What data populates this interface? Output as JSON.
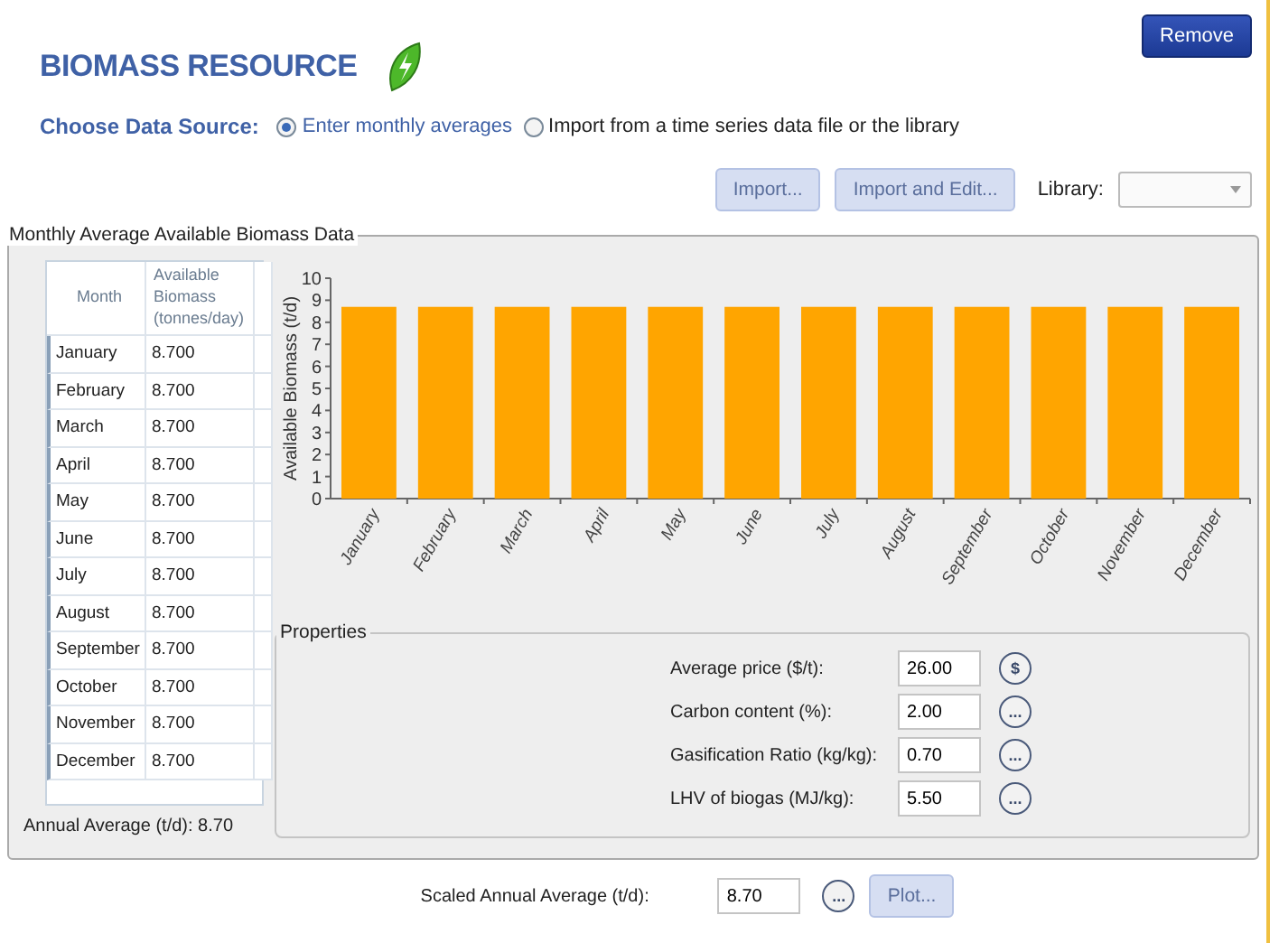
{
  "header": {
    "title": "BIOMASS RESOURCE",
    "remove_button": "Remove"
  },
  "data_source": {
    "label": "Choose Data Source:",
    "options": [
      {
        "label": "Enter monthly averages",
        "selected": true
      },
      {
        "label": "Import from a time series data file or the library",
        "selected": false
      }
    ]
  },
  "import_bar": {
    "buttons": [
      {
        "label": "Import...",
        "disabled": true
      },
      {
        "label": "Import and Edit...",
        "disabled": true
      }
    ],
    "library_label": "Library:"
  },
  "monthly_group": {
    "title": "Monthly Average Available Biomass Data",
    "table": {
      "columns": [
        "Month",
        "Available Biomass (tonnes/day)"
      ],
      "rows": [
        {
          "month": "January",
          "value": "8.700"
        },
        {
          "month": "February",
          "value": "8.700"
        },
        {
          "month": "March",
          "value": "8.700"
        },
        {
          "month": "April",
          "value": "8.700"
        },
        {
          "month": "May",
          "value": "8.700"
        },
        {
          "month": "June",
          "value": "8.700"
        },
        {
          "month": "July",
          "value": "8.700"
        },
        {
          "month": "August",
          "value": "8.700"
        },
        {
          "month": "September",
          "value": "8.700"
        },
        {
          "month": "October",
          "value": "8.700"
        },
        {
          "month": "November",
          "value": "8.700"
        },
        {
          "month": "December",
          "value": "8.700"
        }
      ]
    },
    "annual_average": "Annual Average (t/d): 8.70",
    "chart_data": {
      "type": "bar",
      "ylabel": "Available Biomass (t/d)",
      "categories": [
        "January",
        "February",
        "March",
        "April",
        "May",
        "June",
        "July",
        "August",
        "September",
        "October",
        "November",
        "December"
      ],
      "series": [
        {
          "color": "#ffa500",
          "values": [
            8.7,
            8.7,
            8.7,
            8.7,
            8.7,
            8.7,
            8.7,
            8.7,
            8.7,
            8.7,
            8.7,
            8.7
          ]
        }
      ],
      "ylim": [
        0,
        10
      ],
      "yticks": [
        0,
        1,
        2,
        3,
        4,
        5,
        6,
        7,
        8,
        9,
        10
      ]
    },
    "properties": {
      "title": "Properties",
      "fields": [
        {
          "label": "Average price ($/t):",
          "value": "26.00",
          "button": "$"
        },
        {
          "label": "Carbon content (%):",
          "value": "2.00",
          "button": "..."
        },
        {
          "label": "Gasification Ratio (kg/kg):",
          "value": "0.70",
          "button": "..."
        },
        {
          "label": "LHV of biogas (MJ/kg):",
          "value": "5.50",
          "button": "..."
        }
      ]
    }
  },
  "scaled": {
    "label": "Scaled Annual Average (t/d):",
    "value": "8.70",
    "button": "...",
    "plot_button": {
      "label": "Plot...",
      "disabled": true
    }
  }
}
